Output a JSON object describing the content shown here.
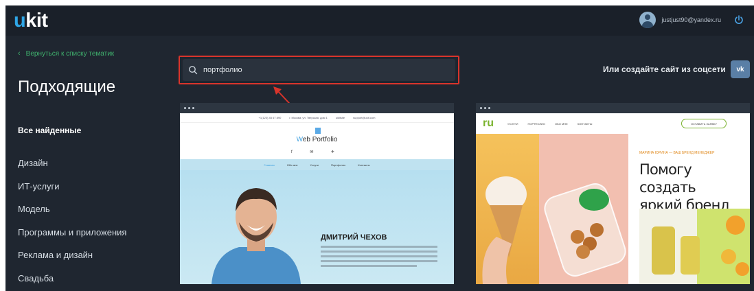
{
  "header": {
    "logo_prefix": "u",
    "logo_rest": "kit",
    "user_email": "justjust90@yandex.ru"
  },
  "sidebar": {
    "back_label": "Вернуться к списку тематик",
    "title": "Подходящие",
    "all_found": "Все найденные",
    "categories": [
      "Дизайн",
      "ИТ-услуги",
      "Модель",
      "Программы и приложения",
      "Реклама и дизайн",
      "Свадьба"
    ]
  },
  "search": {
    "value": "портфолио"
  },
  "social": {
    "text": "Или создайте сайт из соцсети",
    "vk_label": "vk"
  },
  "card1": {
    "contacts": [
      "+1(123) 45 67 890",
      "г. Москва, ул. Тверская, дом 1",
      "uikitsite",
      "support@ukit.com"
    ],
    "site_title_first": "W",
    "site_title_rest": "eb Portfolio",
    "nav": [
      "Главная",
      "Обо мне",
      "Услуги",
      "Портфолио",
      "Контакты"
    ],
    "name": "ДМИТРИЙ ЧЕХОВ"
  },
  "card2": {
    "logo": "ru",
    "nav": [
      "УСЛУГИ",
      "ПОРТФОЛИО",
      "ОБО МНЕ",
      "КОНТАКТЫ"
    ],
    "cta": "ОСТАВИТЬ ЗАЯВКУ",
    "tag": "МАРИНА ЮРИНА — ВАШ БРЕНД МЕНЕДЖЕР",
    "headline_1": "Помогу создать",
    "headline_2": "яркий бренд"
  },
  "colors": {
    "background": "#1f2630",
    "accent_green": "#3fb06d",
    "highlight_red": "#d9342b",
    "logo_blue": "#2fa6e6"
  }
}
